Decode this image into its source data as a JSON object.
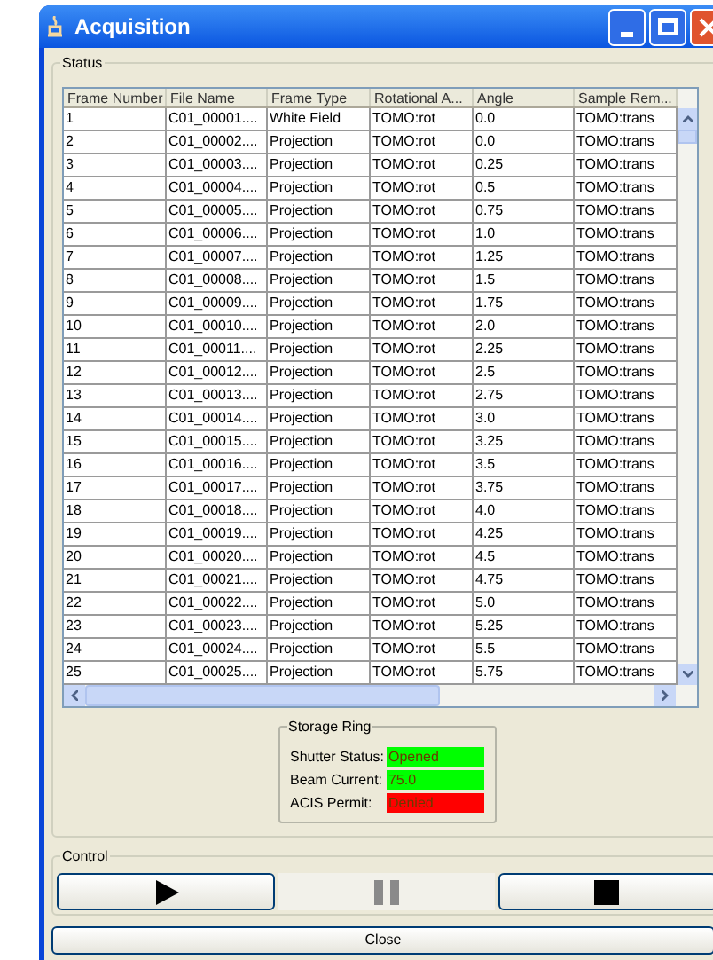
{
  "window": {
    "title": "Acquisition"
  },
  "status": {
    "label": "Status",
    "table": {
      "columns": [
        "Frame Number",
        "File Name",
        "Frame Type",
        "Rotational A...",
        "Angle",
        "Sample Rem..."
      ],
      "rows": [
        [
          "1",
          "C01_00001....",
          "White Field",
          "TOMO:rot",
          "0.0",
          "TOMO:trans"
        ],
        [
          "2",
          "C01_00002....",
          "Projection",
          "TOMO:rot",
          "0.0",
          "TOMO:trans"
        ],
        [
          "3",
          "C01_00003....",
          "Projection",
          "TOMO:rot",
          "0.25",
          "TOMO:trans"
        ],
        [
          "4",
          "C01_00004....",
          "Projection",
          "TOMO:rot",
          "0.5",
          "TOMO:trans"
        ],
        [
          "5",
          "C01_00005....",
          "Projection",
          "TOMO:rot",
          "0.75",
          "TOMO:trans"
        ],
        [
          "6",
          "C01_00006....",
          "Projection",
          "TOMO:rot",
          "1.0",
          "TOMO:trans"
        ],
        [
          "7",
          "C01_00007....",
          "Projection",
          "TOMO:rot",
          "1.25",
          "TOMO:trans"
        ],
        [
          "8",
          "C01_00008....",
          "Projection",
          "TOMO:rot",
          "1.5",
          "TOMO:trans"
        ],
        [
          "9",
          "C01_00009....",
          "Projection",
          "TOMO:rot",
          "1.75",
          "TOMO:trans"
        ],
        [
          "10",
          "C01_00010....",
          "Projection",
          "TOMO:rot",
          "2.0",
          "TOMO:trans"
        ],
        [
          "11",
          "C01_00011....",
          "Projection",
          "TOMO:rot",
          "2.25",
          "TOMO:trans"
        ],
        [
          "12",
          "C01_00012....",
          "Projection",
          "TOMO:rot",
          "2.5",
          "TOMO:trans"
        ],
        [
          "13",
          "C01_00013....",
          "Projection",
          "TOMO:rot",
          "2.75",
          "TOMO:trans"
        ],
        [
          "14",
          "C01_00014....",
          "Projection",
          "TOMO:rot",
          "3.0",
          "TOMO:trans"
        ],
        [
          "15",
          "C01_00015....",
          "Projection",
          "TOMO:rot",
          "3.25",
          "TOMO:trans"
        ],
        [
          "16",
          "C01_00016....",
          "Projection",
          "TOMO:rot",
          "3.5",
          "TOMO:trans"
        ],
        [
          "17",
          "C01_00017....",
          "Projection",
          "TOMO:rot",
          "3.75",
          "TOMO:trans"
        ],
        [
          "18",
          "C01_00018....",
          "Projection",
          "TOMO:rot",
          "4.0",
          "TOMO:trans"
        ],
        [
          "19",
          "C01_00019....",
          "Projection",
          "TOMO:rot",
          "4.25",
          "TOMO:trans"
        ],
        [
          "20",
          "C01_00020....",
          "Projection",
          "TOMO:rot",
          "4.5",
          "TOMO:trans"
        ],
        [
          "21",
          "C01_00021....",
          "Projection",
          "TOMO:rot",
          "4.75",
          "TOMO:trans"
        ],
        [
          "22",
          "C01_00022....",
          "Projection",
          "TOMO:rot",
          "5.0",
          "TOMO:trans"
        ],
        [
          "23",
          "C01_00023....",
          "Projection",
          "TOMO:rot",
          "5.25",
          "TOMO:trans"
        ],
        [
          "24",
          "C01_00024....",
          "Projection",
          "TOMO:rot",
          "5.5",
          "TOMO:trans"
        ],
        [
          "25",
          "C01_00025....",
          "Projection",
          "TOMO:rot",
          "5.75",
          "TOMO:trans"
        ]
      ]
    },
    "storage_ring": {
      "label": "Storage Ring",
      "fields": [
        {
          "label": "Shutter Status:",
          "value": "Opened",
          "color": "#00ff00"
        },
        {
          "label": "Beam Current:",
          "value": "75.0",
          "color": "#00ff00"
        },
        {
          "label": "ACIS Permit:",
          "value": "Denied",
          "color": "#ff0000"
        }
      ]
    }
  },
  "control": {
    "label": "Control",
    "buttons": [
      {
        "kind": "play",
        "disabled": false
      },
      {
        "kind": "pause",
        "disabled": true
      },
      {
        "kind": "stop",
        "disabled": false
      }
    ]
  },
  "close_button": "Close"
}
